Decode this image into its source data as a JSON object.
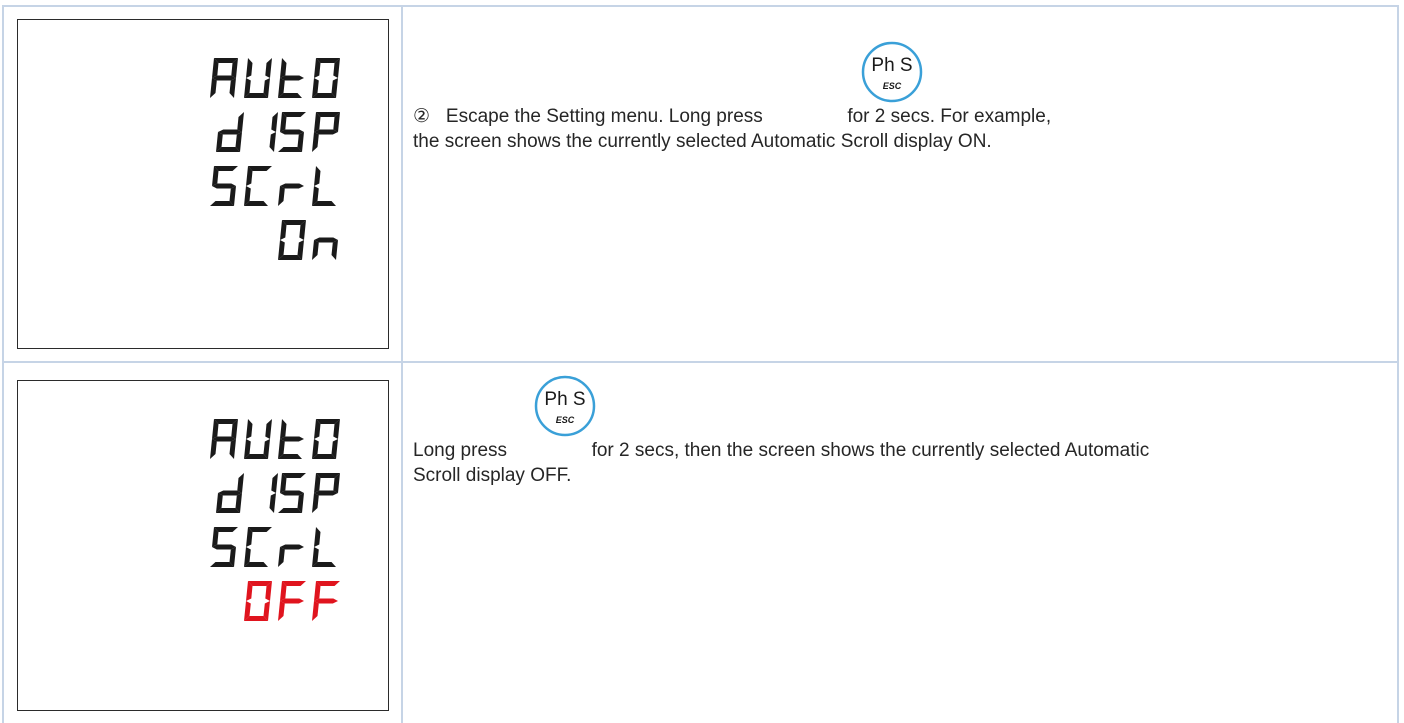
{
  "rows": [
    {
      "display": {
        "lines": [
          "AUtO",
          "dI SP",
          "SCrL",
          "On"
        ],
        "highlight_line": 3,
        "highlight_color": "#1a1a1a"
      },
      "instruction": {
        "number": "②",
        "text_before": "Escape the Setting menu. Long press",
        "text_after": "for 2 secs. For example,",
        "line2": "the screen shows the currently selected Automatic Scroll display ON."
      },
      "button": {
        "label": "Ph S",
        "sublabel": "ESC",
        "icon": "phs-esc-button-icon"
      }
    },
    {
      "display": {
        "lines": [
          "AUtO",
          "dI SP",
          "SCrL",
          "OFF"
        ],
        "highlight_line": 3,
        "highlight_color": "#e0141e"
      },
      "instruction": {
        "text_before": "Long press",
        "text_after": "for 2 secs, then the screen shows the currently selected Automatic",
        "line2": "Scroll display OFF."
      },
      "button": {
        "label": "Ph S",
        "sublabel": "ESC",
        "icon": "phs-esc-button-icon"
      }
    }
  ],
  "colors": {
    "grid": "#c6d4e6",
    "segment": "#1a1a1a",
    "segment_off": "#e0141e",
    "button_ring": "#3aa0d8"
  }
}
